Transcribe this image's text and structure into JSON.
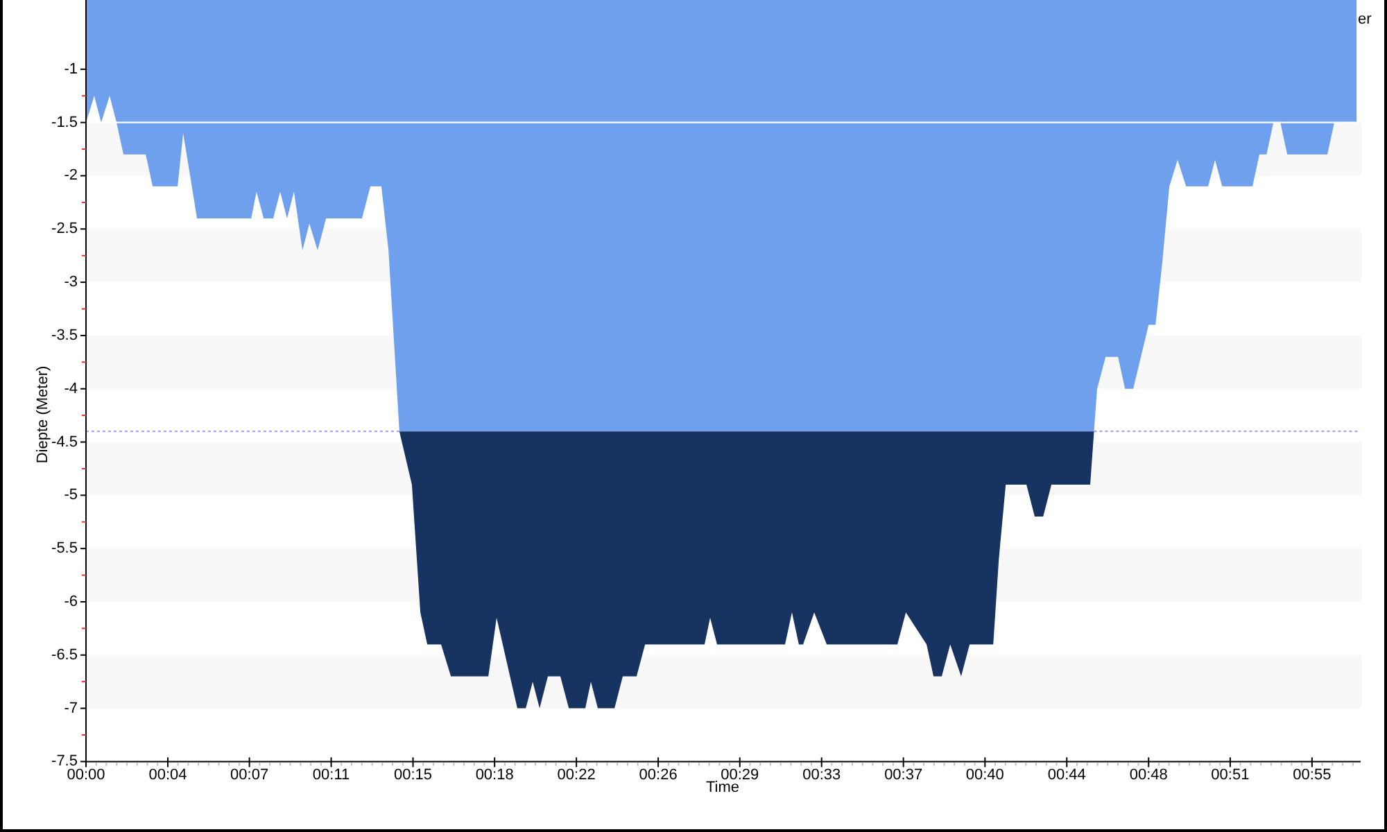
{
  "chart": {
    "legend": "er",
    "chart_data": {
      "type": "area",
      "xlabel": "Time",
      "ylabel": "Diepte (Meter)",
      "x": [
        0,
        0.37,
        0.68,
        1.06,
        1.37,
        1.68,
        2.68,
        2.99,
        4.11,
        4.36,
        4.98,
        7.41,
        7.65,
        7.97,
        8.4,
        8.71,
        9.02,
        9.33,
        9.71,
        10.02,
        10.39,
        10.77,
        12.38,
        12.76,
        13.25,
        13.57,
        14.06,
        14.62,
        15,
        15.31,
        15.93,
        16.37,
        18.05,
        18.42,
        19.35,
        19.73,
        20.04,
        20.35,
        20.72,
        21.28,
        21.66,
        22.4,
        22.65,
        22.96,
        23.71,
        24.08,
        24.7,
        25.08,
        27.75,
        28,
        28.31,
        31.36,
        31.67,
        31.98,
        32.17,
        32.67,
        33.23,
        36.4,
        36.78,
        37.71,
        38.02,
        38.39,
        38.77,
        39.26,
        39.64,
        40.7,
        40.95,
        41.26,
        42.19,
        42.56,
        42.94,
        43.31,
        45.05,
        45.22,
        45.36,
        45.74,
        46.3,
        46.61,
        46.98,
        47.67,
        47.98,
        48.29,
        48.6,
        48.97,
        49.35,
        50.34,
        50.65,
        50.97,
        52.33,
        52.64,
        52.96,
        53.27,
        53.58,
        53.89,
        55.69,
        56,
        57
      ],
      "series": [
        {
          "color": "#6fa0ee",
          "values": [
            -1.5,
            -1.25,
            -1.5,
            -1.25,
            -1.5,
            -1.8,
            -1.8,
            -2.1,
            -2.1,
            -1.6,
            -2.4,
            -2.4,
            -2.15,
            -2.4,
            -2.4,
            -2.15,
            -2.4,
            -2.15,
            -2.7,
            -2.45,
            -2.7,
            -2.4,
            -2.4,
            -2.1,
            -2.1,
            -2.7,
            -4.4,
            -4.4,
            -4.4,
            -4.4,
            -4.4,
            -4.4,
            -4.4,
            -4.4,
            -4.4,
            -4.4,
            -4.4,
            -4.4,
            -4.4,
            -4.4,
            -4.4,
            -4.4,
            -4.4,
            -4.4,
            -4.4,
            -4.4,
            -4.4,
            -4.4,
            -4.4,
            -4.4,
            -4.4,
            -4.4,
            -4.4,
            -4.4,
            -4.4,
            -4.4,
            -4.4,
            -4.4,
            -4.4,
            -4.4,
            -4.4,
            -4.4,
            -4.4,
            -4.4,
            -4.4,
            -4.4,
            -4.4,
            -4.4,
            -4.4,
            -4.4,
            -4.4,
            -4.4,
            -4.4,
            -4.4,
            -4,
            -3.7,
            -3.7,
            -4,
            -4,
            -3.4,
            -3.4,
            -2.8,
            -2.1,
            -1.85,
            -2.1,
            -2.1,
            -1.85,
            -2.1,
            -2.1,
            -1.8,
            -1.8,
            -1.5,
            -1.5,
            -1.8,
            -1.8,
            -1.5,
            -1.5
          ]
        },
        {
          "color": "#173361",
          "values": [
            null,
            null,
            null,
            null,
            null,
            null,
            null,
            null,
            null,
            null,
            null,
            null,
            null,
            null,
            null,
            null,
            null,
            null,
            null,
            null,
            null,
            null,
            null,
            null,
            null,
            null,
            -4.4,
            -4.9,
            -6.1,
            -6.4,
            -6.4,
            -6.7,
            -6.7,
            -6.15,
            -7,
            -7,
            -6.75,
            -7,
            -6.7,
            -6.7,
            -7,
            -7,
            -6.75,
            -7,
            -7,
            -6.7,
            -6.7,
            -6.4,
            -6.4,
            -6.15,
            -6.4,
            -6.4,
            -6.1,
            -6.4,
            -6.4,
            -6.1,
            -6.4,
            -6.4,
            -6.1,
            -6.4,
            -6.7,
            -6.7,
            -6.4,
            -6.7,
            -6.4,
            -6.4,
            -5.6,
            -4.9,
            -4.9,
            -5.2,
            -5.2,
            -4.9,
            -4.9,
            -4.4,
            null,
            null,
            null,
            null,
            null,
            null,
            null,
            null,
            null,
            null,
            null,
            null,
            null,
            null,
            null,
            null,
            null,
            null,
            null,
            null,
            null,
            null,
            null
          ]
        }
      ],
      "xlim": [
        0,
        57.12
      ],
      "ylim": [
        -7.5,
        -0.35
      ],
      "xticks": [
        {
          "value": 0,
          "label": "00:00"
        },
        {
          "value": 3.67,
          "label": "00:04"
        },
        {
          "value": 7.33,
          "label": "00:07"
        },
        {
          "value": 11,
          "label": "00:11"
        },
        {
          "value": 14.67,
          "label": "00:15"
        },
        {
          "value": 18.33,
          "label": "00:18"
        },
        {
          "value": 22,
          "label": "00:22"
        },
        {
          "value": 25.67,
          "label": "00:26"
        },
        {
          "value": 29.33,
          "label": "00:29"
        },
        {
          "value": 33,
          "label": "00:33"
        },
        {
          "value": 36.67,
          "label": "00:37"
        },
        {
          "value": 40.33,
          "label": "00:40"
        },
        {
          "value": 44,
          "label": "00:44"
        },
        {
          "value": 47.67,
          "label": "00:48"
        },
        {
          "value": 51.33,
          "label": "00:51"
        },
        {
          "value": 55,
          "label": "00:55"
        }
      ],
      "yticks": [
        -1,
        -1.5,
        -2,
        -2.5,
        -3,
        -3.5,
        -4,
        -4.5,
        -5,
        -5.5,
        -6,
        -6.5,
        -7,
        -7.5
      ],
      "ref_lines": [
        {
          "axis": "y",
          "value": -1.5,
          "color": "#ffffff"
        },
        {
          "axis": "y",
          "value": -4.4,
          "color": "#a4a4f2"
        }
      ]
    }
  }
}
